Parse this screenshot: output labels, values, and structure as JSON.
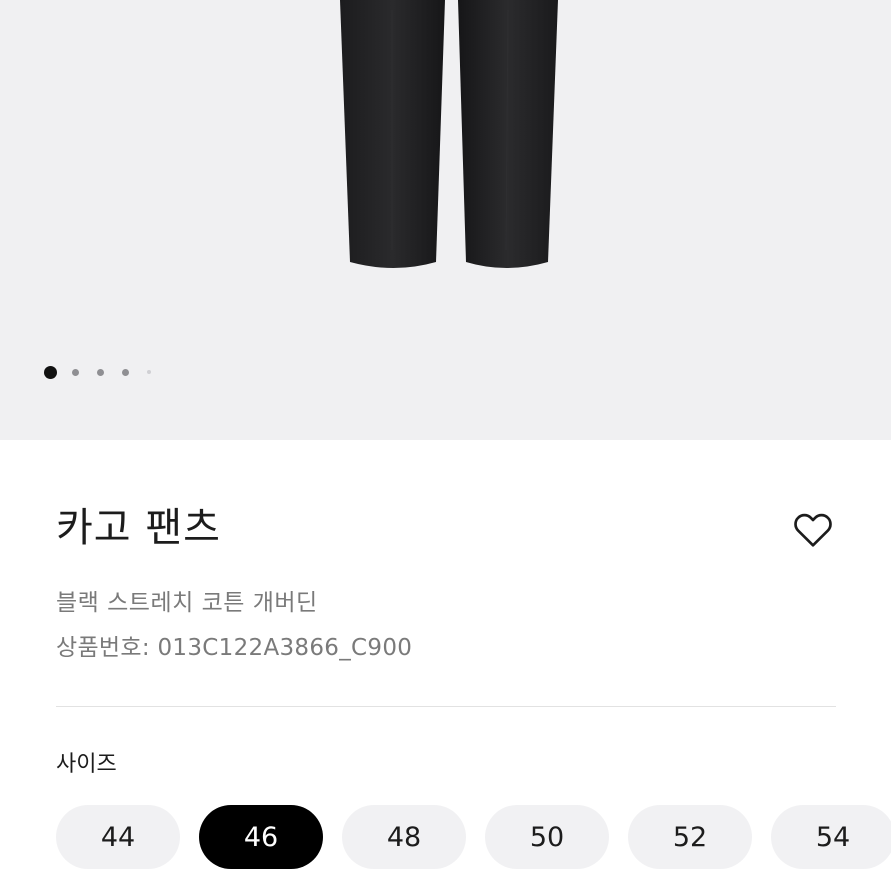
{
  "product": {
    "name": "카고 팬츠",
    "description": "블랙 스트레치 코튼 개버딘",
    "code": "상품번호: 013C122A3866_C900"
  },
  "gallery": {
    "image_alt": "black cargo pants product photo",
    "image_count": 5,
    "active_index": 0
  },
  "size_section": {
    "label": "사이즈",
    "options": [
      "44",
      "46",
      "48",
      "50",
      "52",
      "54"
    ],
    "selected": "46"
  },
  "icons": {
    "wishlist": "heart-outline-icon"
  },
  "colors": {
    "hero_bg": "#f0f0f2",
    "selected_size_bg": "#000000",
    "size_bg": "#f1f1f3",
    "muted_text": "#7a7a7a"
  }
}
